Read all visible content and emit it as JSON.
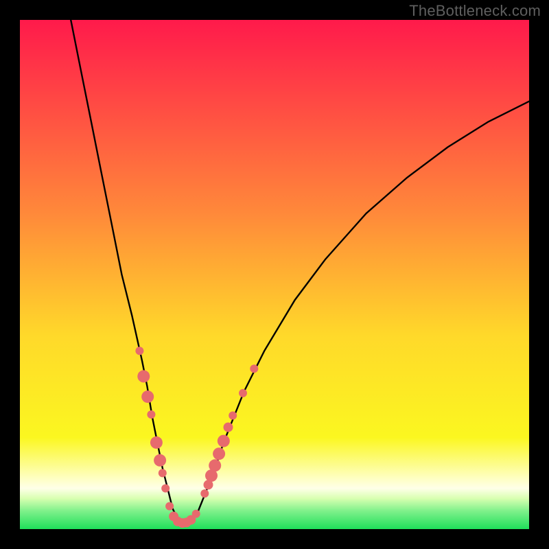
{
  "watermark": "TheBottleneck.com",
  "colors": {
    "frame": "#000000",
    "curve": "#000000",
    "dot_fill": "#e76a6d",
    "dot_stroke": "#d95a5d",
    "grad_top": "#ff1a4b",
    "grad_mid1": "#ff893a",
    "grad_mid2": "#ffd92a",
    "grad_yellow": "#fbf720",
    "grad_pale": "#feffc2",
    "grad_green": "#1fe05a"
  },
  "chart_data": {
    "type": "line",
    "title": "",
    "xlabel": "",
    "ylabel": "",
    "xlim": [
      0,
      100
    ],
    "ylim": [
      0,
      100
    ],
    "series": [
      {
        "name": "bottleneck-curve",
        "x": [
          10,
          12,
          14,
          16,
          18,
          20,
          22,
          24,
          25,
          26,
          27,
          28,
          29,
          30,
          31,
          32,
          33,
          34,
          35,
          36,
          38,
          40,
          44,
          48,
          54,
          60,
          68,
          76,
          84,
          92,
          100
        ],
        "y": [
          100,
          90,
          80,
          70,
          60,
          50,
          42,
          33,
          28,
          22,
          17,
          12,
          8,
          4,
          2,
          1,
          1,
          2,
          3.5,
          6,
          11,
          17,
          27,
          35,
          45,
          53,
          62,
          69,
          75,
          80,
          84
        ]
      }
    ],
    "dots_left": [
      {
        "x": 23.5,
        "y": 35.0,
        "r": 6
      },
      {
        "x": 24.3,
        "y": 30.0,
        "r": 9
      },
      {
        "x": 25.1,
        "y": 26.0,
        "r": 9
      },
      {
        "x": 25.8,
        "y": 22.5,
        "r": 6
      },
      {
        "x": 26.8,
        "y": 17.0,
        "r": 9
      },
      {
        "x": 27.5,
        "y": 13.5,
        "r": 9
      },
      {
        "x": 28.0,
        "y": 11.0,
        "r": 6
      },
      {
        "x": 28.6,
        "y": 8.0,
        "r": 6
      }
    ],
    "dots_bottom": [
      {
        "x": 29.4,
        "y": 4.5,
        "r": 6
      },
      {
        "x": 30.2,
        "y": 2.5,
        "r": 7
      },
      {
        "x": 31.0,
        "y": 1.5,
        "r": 7
      },
      {
        "x": 31.9,
        "y": 1.2,
        "r": 7
      },
      {
        "x": 32.7,
        "y": 1.3,
        "r": 7
      },
      {
        "x": 33.6,
        "y": 1.8,
        "r": 7
      },
      {
        "x": 34.6,
        "y": 3.0,
        "r": 6
      }
    ],
    "dots_right": [
      {
        "x": 36.3,
        "y": 7.0,
        "r": 6
      },
      {
        "x": 37.0,
        "y": 8.7,
        "r": 7
      },
      {
        "x": 37.6,
        "y": 10.5,
        "r": 9
      },
      {
        "x": 38.3,
        "y": 12.5,
        "r": 9
      },
      {
        "x": 39.1,
        "y": 14.8,
        "r": 9
      },
      {
        "x": 40.0,
        "y": 17.3,
        "r": 9
      },
      {
        "x": 40.9,
        "y": 20.0,
        "r": 7
      },
      {
        "x": 41.8,
        "y": 22.3,
        "r": 6
      },
      {
        "x": 43.8,
        "y": 26.7,
        "r": 6
      },
      {
        "x": 46.0,
        "y": 31.5,
        "r": 6
      }
    ]
  }
}
